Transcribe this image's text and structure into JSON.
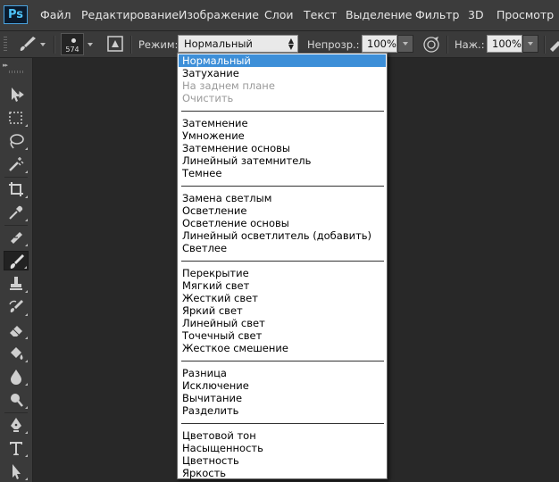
{
  "app": {
    "logo": "Ps"
  },
  "menu": [
    "Файл",
    "Редактирование",
    "Изображение",
    "Слои",
    "Текст",
    "Выделение",
    "Фильтр",
    "3D",
    "Просмотр"
  ],
  "options": {
    "tool_icon": "brush-icon",
    "brush_size": "574",
    "mode_label": "Режим:",
    "mode_value": "Нормальный",
    "opacity_label": "Непрозр.:",
    "opacity_value": "100%",
    "flow_label": "Наж.:",
    "flow_value": "100%"
  },
  "tools": [
    "move-tool-icon",
    "marquee-tool-icon",
    "lasso-tool-icon",
    "magic-wand-tool-icon",
    "crop-tool-icon",
    "eyedropper-tool-icon",
    "healing-brush-tool-icon",
    "brush-tool-icon",
    "clone-stamp-tool-icon",
    "history-brush-tool-icon",
    "eraser-tool-icon",
    "paint-bucket-tool-icon",
    "blur-tool-icon",
    "dodge-tool-icon",
    "pen-tool-icon",
    "type-tool-icon",
    "path-selection-tool-icon"
  ],
  "active_tool": "brush-tool-icon",
  "blend_modes": {
    "selected": "Нормальный",
    "groups": [
      [
        {
          "label": "Нормальный",
          "state": "selected"
        },
        {
          "label": "Затухание",
          "state": "normal"
        },
        {
          "label": "На заднем плане",
          "state": "disabled"
        },
        {
          "label": "Очистить",
          "state": "disabled"
        }
      ],
      [
        {
          "label": "Затемнение",
          "state": "normal"
        },
        {
          "label": "Умножение",
          "state": "normal"
        },
        {
          "label": "Затемнение основы",
          "state": "normal"
        },
        {
          "label": "Линейный затемнитель",
          "state": "normal"
        },
        {
          "label": "Темнее",
          "state": "normal"
        }
      ],
      [
        {
          "label": "Замена светлым",
          "state": "normal"
        },
        {
          "label": "Осветление",
          "state": "normal"
        },
        {
          "label": "Осветление основы",
          "state": "normal"
        },
        {
          "label": "Линейный осветлитель (добавить)",
          "state": "normal"
        },
        {
          "label": "Светлее",
          "state": "normal"
        }
      ],
      [
        {
          "label": "Перекрытие",
          "state": "normal"
        },
        {
          "label": "Мягкий свет",
          "state": "normal"
        },
        {
          "label": "Жесткий свет",
          "state": "normal"
        },
        {
          "label": "Яркий свет",
          "state": "normal"
        },
        {
          "label": "Линейный свет",
          "state": "normal"
        },
        {
          "label": "Точечный свет",
          "state": "normal"
        },
        {
          "label": "Жесткое смешение",
          "state": "normal"
        }
      ],
      [
        {
          "label": "Разница",
          "state": "normal"
        },
        {
          "label": "Исключение",
          "state": "normal"
        },
        {
          "label": "Вычитание",
          "state": "normal"
        },
        {
          "label": "Разделить",
          "state": "normal"
        }
      ],
      [
        {
          "label": "Цветовой тон",
          "state": "normal"
        },
        {
          "label": "Насыщенность",
          "state": "normal"
        },
        {
          "label": "Цветность",
          "state": "normal"
        },
        {
          "label": "Яркость",
          "state": "normal"
        }
      ]
    ]
  },
  "colors": {
    "selection": "#3d8fd8",
    "chrome": "#3a3a3a",
    "disabled_text": "#9a9a9a"
  }
}
